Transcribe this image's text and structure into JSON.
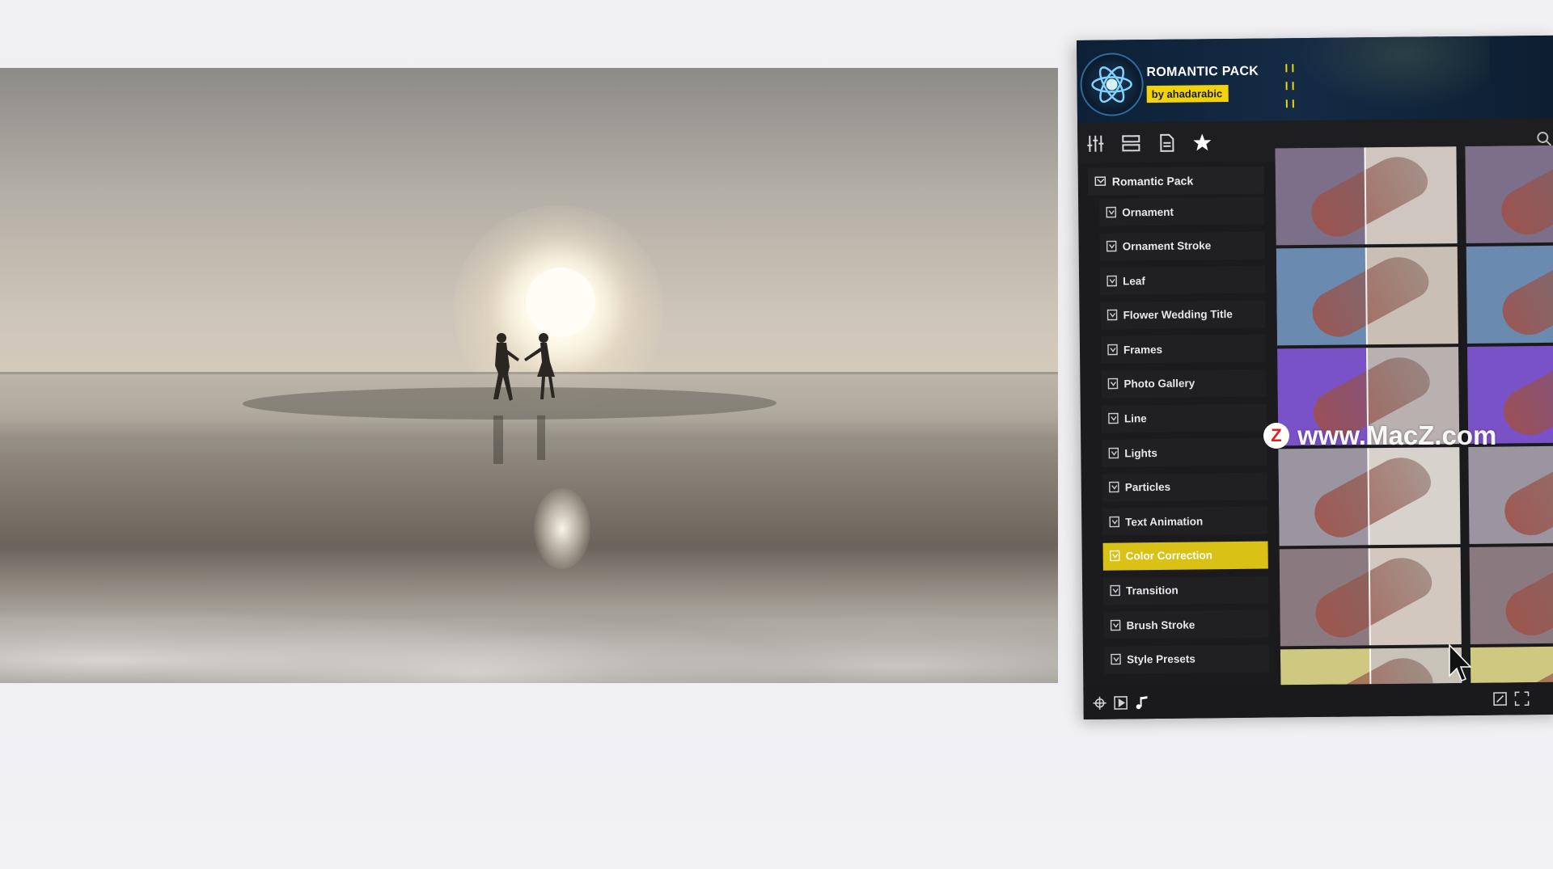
{
  "panel": {
    "title": "ROMANTIC PACK",
    "author": "by ahadarabic",
    "root_item": "Romantic Pack",
    "items": [
      {
        "label": "Ornament"
      },
      {
        "label": "Ornament Stroke"
      },
      {
        "label": "Leaf"
      },
      {
        "label": "Flower Wedding Title"
      },
      {
        "label": "Frames"
      },
      {
        "label": "Photo Gallery"
      },
      {
        "label": "Line"
      },
      {
        "label": "Lights"
      },
      {
        "label": "Particles"
      },
      {
        "label": "Text Animation"
      },
      {
        "label": "Color Correction",
        "selected": true
      },
      {
        "label": "Transition"
      },
      {
        "label": "Brush Stroke"
      },
      {
        "label": "Style Presets"
      }
    ],
    "toolbar_icons": [
      "sliders-icon",
      "layout-icon",
      "document-icon",
      "star-icon"
    ],
    "footer_icons": [
      "move-icon",
      "play-icon",
      "music-icon",
      "resize-icon",
      "fullscreen-icon"
    ],
    "accent_color": "#d9c116",
    "header_color": "#0d2035"
  },
  "watermark": {
    "text": "www.MacZ.com",
    "badge": "Z"
  }
}
